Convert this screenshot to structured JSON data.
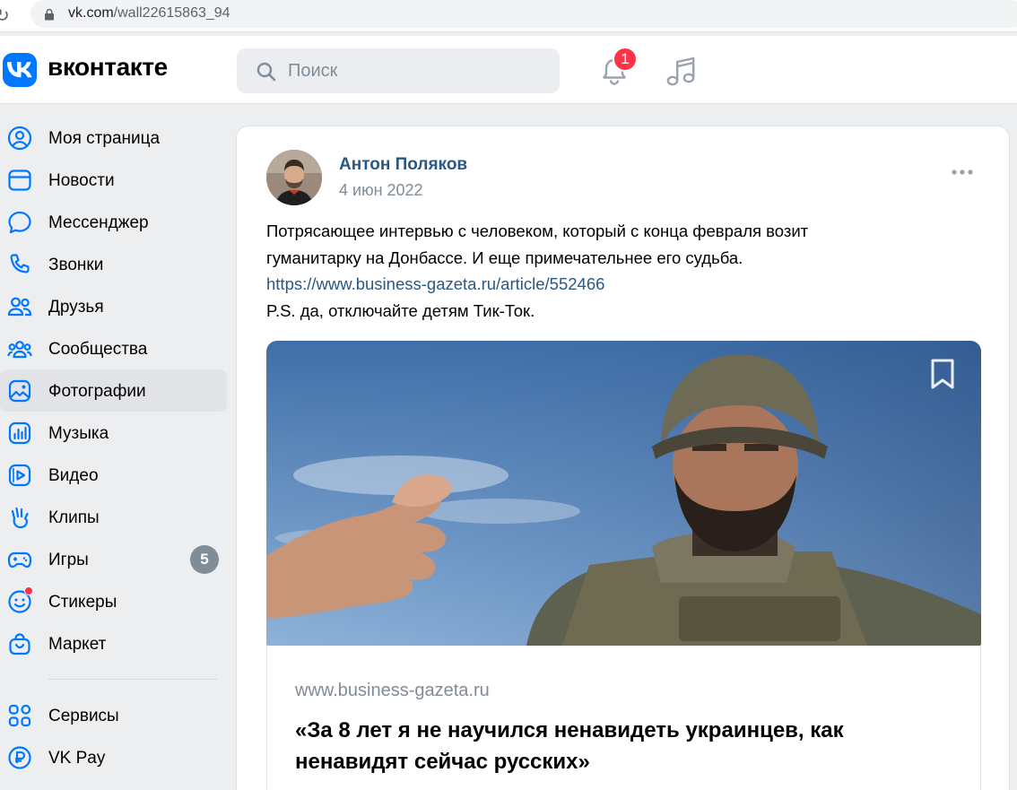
{
  "browser": {
    "url_domain": "vk.com",
    "url_path": "/wall22615863_94"
  },
  "header": {
    "logo_text": "вконтакте",
    "search_placeholder": "Поиск",
    "notifications_count": "1"
  },
  "sidebar": {
    "items": [
      {
        "label": "Моя страница",
        "icon": "user-circle-icon"
      },
      {
        "label": "Новости",
        "icon": "news-icon"
      },
      {
        "label": "Мессенджер",
        "icon": "message-icon"
      },
      {
        "label": "Звонки",
        "icon": "phone-icon"
      },
      {
        "label": "Друзья",
        "icon": "friends-icon"
      },
      {
        "label": "Сообщества",
        "icon": "communities-icon"
      },
      {
        "label": "Фотографии",
        "icon": "photo-icon",
        "active": true
      },
      {
        "label": "Музыка",
        "icon": "music-icon"
      },
      {
        "label": "Видео",
        "icon": "video-icon"
      },
      {
        "label": "Клипы",
        "icon": "clips-icon"
      },
      {
        "label": "Игры",
        "icon": "gamepad-icon",
        "count": "5"
      },
      {
        "label": "Стикеры",
        "icon": "sticker-icon"
      },
      {
        "label": "Маркет",
        "icon": "market-icon"
      }
    ],
    "bottom_items": [
      {
        "label": "Сервисы",
        "icon": "services-icon"
      },
      {
        "label": "VK Pay",
        "icon": "vkpay-icon"
      }
    ]
  },
  "post": {
    "author": "Антон Поляков",
    "date": "4 июн 2022",
    "text_lines": [
      "Потрясающее интервью с человеком, который с конца февраля возит",
      "гуманитарку на Донбассе. И еще примечательнее его судьба."
    ],
    "link": "https://www.business-gazeta.ru/article/552466",
    "ps": "P.S. да, отключайте детям Тик-Ток.",
    "attachment": {
      "domain": "www.business-gazeta.ru",
      "title": "«За 8 лет я не научился ненавидеть украинцев, как ненавидят сейчас русских»"
    }
  },
  "colors": {
    "accent": "#0077ff",
    "link": "#2a5885",
    "badge": "#ff3347",
    "secondary_text": "#818c99",
    "page_bg": "#edeef0"
  }
}
